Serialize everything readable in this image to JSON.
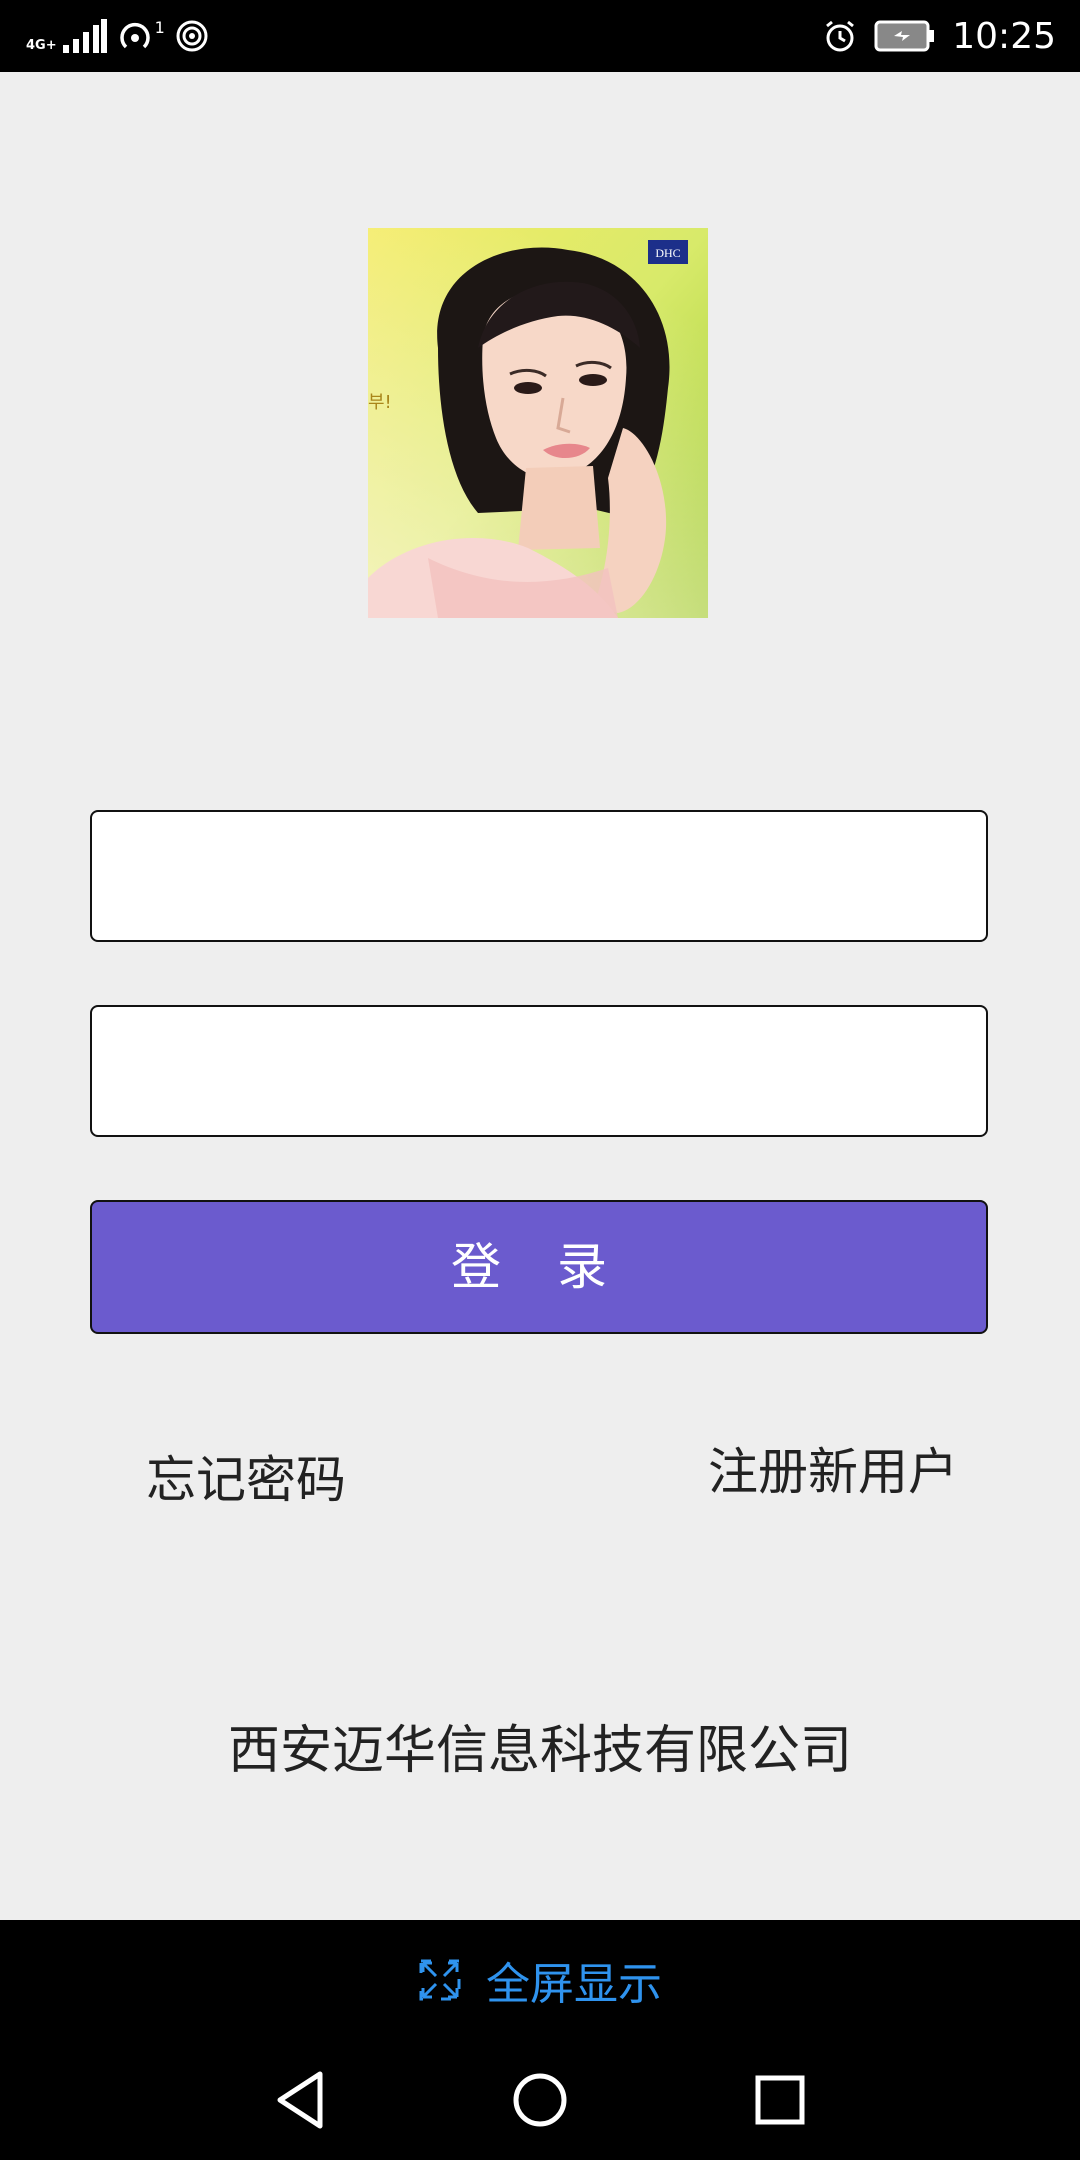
{
  "status": {
    "network_label": "4G+",
    "sim_number": "1",
    "time": "10:25"
  },
  "login": {
    "username_value": "",
    "password_value": "",
    "login_label": "登 录",
    "forgot_password_label": "忘记密码",
    "register_label": "注册新用户"
  },
  "footer": {
    "company": "西安迈华信息科技有限公司"
  },
  "fullscreen": {
    "label": "全屏显示",
    "icon": "fullscreen-icon",
    "color": "#2f93ee"
  },
  "image": {
    "brand_text": "DHC",
    "side_text": "부!"
  },
  "colors": {
    "accent": "#6b5bce",
    "background": "#eeeeee"
  }
}
